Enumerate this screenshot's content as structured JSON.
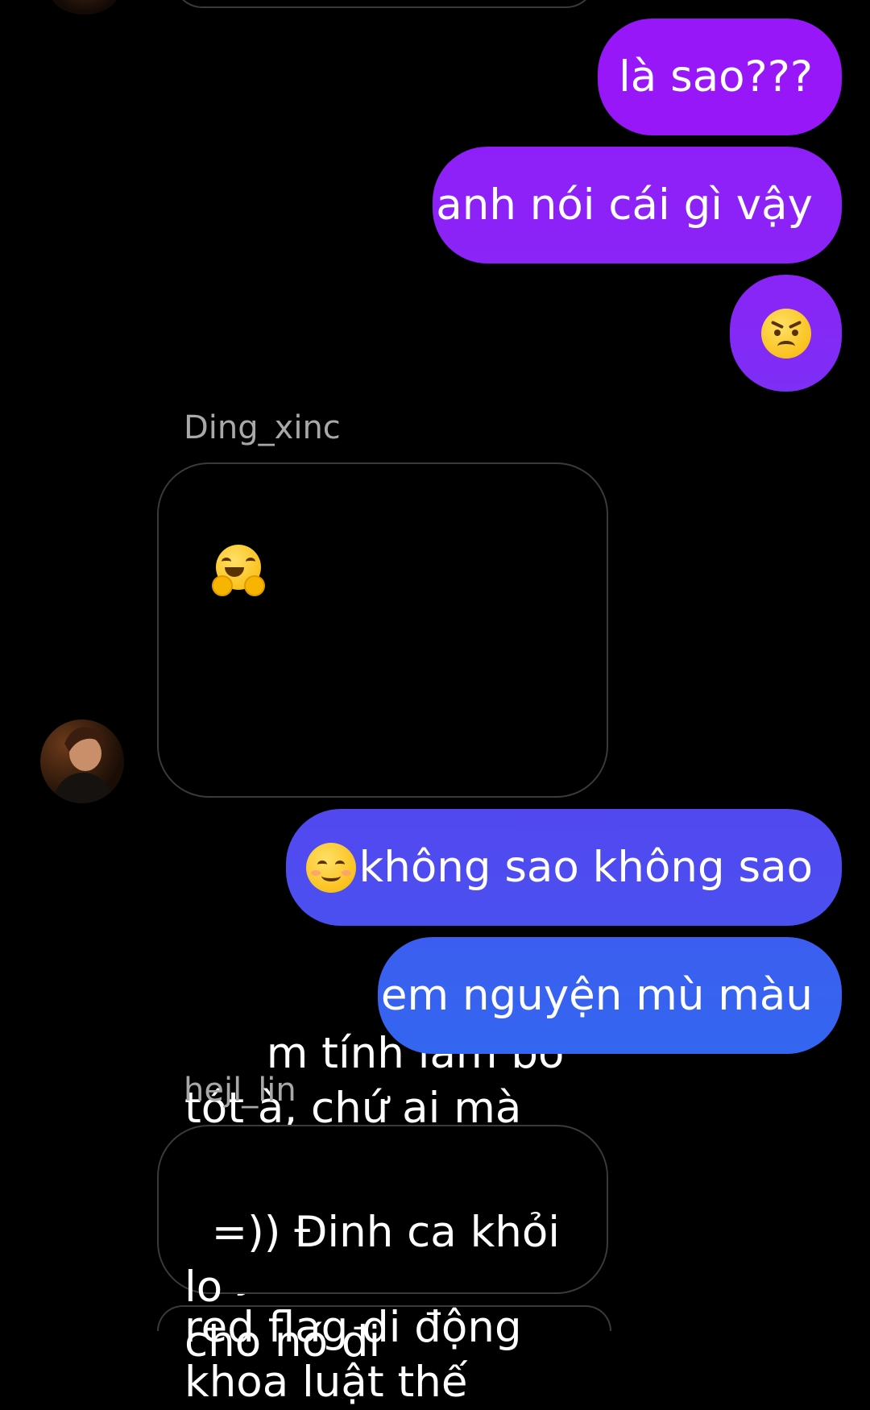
{
  "messages": {
    "m1": {
      "text": "là sao???"
    },
    "m2": {
      "text": "anh nói cái gì vậy"
    },
    "m3": {
      "icon": "angry-face-emoji-icon"
    },
    "sender1": "Ding_xinc",
    "m4": {
      "icon": "hugging-face-emoji-icon",
      "text": "m tính làm bò\ntót à, chứ ai mà lại\nđâm thẳng vào cây\nred flag di động\nkhoa luật thế"
    },
    "m5": {
      "icon": "smiling-face-emoji-icon",
      "text": "không sao không sao"
    },
    "m6": {
      "text": "em nguyện mù màu"
    },
    "sender2": "hejl_lin",
    "m7": {
      "text": "=)) Đinh ca khỏi lo\ncho nó đi"
    }
  },
  "colors": {
    "outgoing_top": "#9a16f8",
    "outgoing_mid": "#6a40f0",
    "outgoing_bottom": "#3366f0",
    "incoming_border": "#3a3a3a",
    "sender_name": "#a8a8a8"
  }
}
